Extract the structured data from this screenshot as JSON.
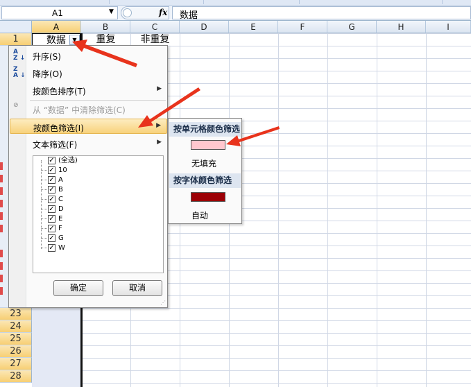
{
  "formula_bar": {
    "name_box": "A1",
    "fx_label": "fx",
    "formula_value": "数据"
  },
  "columns": [
    "A",
    "B",
    "C",
    "D",
    "E",
    "F",
    "G",
    "H",
    "I"
  ],
  "header_row": {
    "row_number": "1",
    "a1": "数据",
    "b1": "重复",
    "c1": "非重复"
  },
  "visible_rows": [
    "23",
    "24",
    "25",
    "26",
    "27",
    "28"
  ],
  "filter_menu": {
    "sort_asc": "升序(S)",
    "sort_desc": "降序(O)",
    "sort_by_color": "按颜色排序(T)",
    "clear_filter": "从 “数据” 中清除筛选(C)",
    "filter_by_color": "按颜色筛选(I)",
    "text_filter": "文本筛选(F)",
    "list_items": [
      {
        "label": "(全选)",
        "checked": true
      },
      {
        "label": "10",
        "checked": true
      },
      {
        "label": "A",
        "checked": true
      },
      {
        "label": "B",
        "checked": true
      },
      {
        "label": "C",
        "checked": true
      },
      {
        "label": "D",
        "checked": true
      },
      {
        "label": "E",
        "checked": true
      },
      {
        "label": "F",
        "checked": true
      },
      {
        "label": "G",
        "checked": true
      },
      {
        "label": "W",
        "checked": true
      }
    ],
    "ok_button": "确定",
    "cancel_button": "取消"
  },
  "color_submenu": {
    "cell_color_header": "按单元格颜色筛选",
    "cell_color_swatch": "#ffc7ce",
    "no_fill": "无填充",
    "font_color_header": "按字体颜色筛选",
    "font_color_swatch": "#9c0006",
    "automatic": "自动"
  },
  "colors": {
    "selected_header": "#f7cf73",
    "menu_highlight": "#f8d27b",
    "arrow_red": "#e8331c"
  }
}
